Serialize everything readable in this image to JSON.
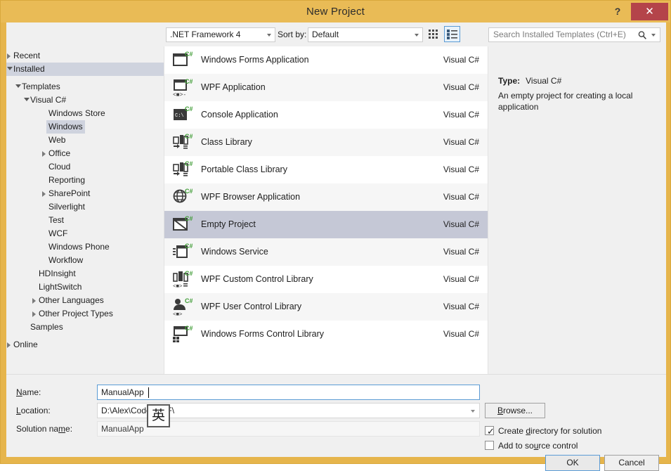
{
  "window": {
    "title": "New Project",
    "help_icon": "question-mark-icon",
    "close_label": "✕"
  },
  "toolbar": {
    "framework": ".NET Framework 4",
    "sort_by_label": "Sort by:",
    "sort_value": "Default",
    "view_medium_icon": "medium-icons-view-icon",
    "view_list_icon": "list-view-icon",
    "search_placeholder": "Search Installed Templates (Ctrl+E)",
    "search_value": "",
    "search_icon": "magnifier-icon"
  },
  "sidebar": {
    "items": [
      {
        "label": "Recent",
        "indent": 10,
        "glyph": "collapsed",
        "selected": false,
        "band": false
      },
      {
        "label": "Installed",
        "indent": 10,
        "glyph": "expanded",
        "selected": false,
        "band": true
      },
      {
        "label": "Templates",
        "indent": 22,
        "glyph": "expanded",
        "selected": false,
        "band": false
      },
      {
        "label": "Visual C#",
        "indent": 34,
        "glyph": "expanded",
        "selected": false,
        "band": false
      },
      {
        "label": "Windows Store",
        "indent": 60,
        "glyph": "none",
        "selected": false,
        "band": false
      },
      {
        "label": "Windows",
        "indent": 60,
        "glyph": "none",
        "selected": true,
        "band": false
      },
      {
        "label": "Web",
        "indent": 60,
        "glyph": "none",
        "selected": false,
        "band": false
      },
      {
        "label": "Office",
        "indent": 60,
        "glyph": "collapsed",
        "selected": false,
        "band": false
      },
      {
        "label": "Cloud",
        "indent": 60,
        "glyph": "none",
        "selected": false,
        "band": false
      },
      {
        "label": "Reporting",
        "indent": 60,
        "glyph": "none",
        "selected": false,
        "band": false
      },
      {
        "label": "SharePoint",
        "indent": 60,
        "glyph": "collapsed",
        "selected": false,
        "band": false
      },
      {
        "label": "Silverlight",
        "indent": 60,
        "glyph": "none",
        "selected": false,
        "band": false
      },
      {
        "label": "Test",
        "indent": 60,
        "glyph": "none",
        "selected": false,
        "band": false
      },
      {
        "label": "WCF",
        "indent": 60,
        "glyph": "none",
        "selected": false,
        "band": false
      },
      {
        "label": "Windows Phone",
        "indent": 60,
        "glyph": "none",
        "selected": false,
        "band": false
      },
      {
        "label": "Workflow",
        "indent": 60,
        "glyph": "none",
        "selected": false,
        "band": false
      },
      {
        "label": "HDInsight",
        "indent": 46,
        "glyph": "none",
        "selected": false,
        "band": false
      },
      {
        "label": "LightSwitch",
        "indent": 46,
        "glyph": "none",
        "selected": false,
        "band": false
      },
      {
        "label": "Other Languages",
        "indent": 46,
        "glyph": "collapsed",
        "selected": false,
        "band": false
      },
      {
        "label": "Other Project Types",
        "indent": 46,
        "glyph": "collapsed",
        "selected": false,
        "band": false
      },
      {
        "label": "Samples",
        "indent": 34,
        "glyph": "none",
        "selected": false,
        "band": false
      },
      {
        "label": "Online",
        "indent": 10,
        "glyph": "collapsed",
        "selected": false,
        "band": false
      }
    ]
  },
  "templates": {
    "items": [
      {
        "name": "Windows Forms Application",
        "lang": "Visual C#",
        "icon": "csharp-winforms-icon",
        "selected": false
      },
      {
        "name": "WPF Application",
        "lang": "Visual C#",
        "icon": "csharp-wpf-icon",
        "selected": false
      },
      {
        "name": "Console Application",
        "lang": "Visual C#",
        "icon": "csharp-console-icon",
        "selected": false
      },
      {
        "name": "Class Library",
        "lang": "Visual C#",
        "icon": "csharp-classlib-icon",
        "selected": false
      },
      {
        "name": "Portable Class Library",
        "lang": "Visual C#",
        "icon": "csharp-portable-classlib-icon",
        "selected": false
      },
      {
        "name": "WPF Browser Application",
        "lang": "Visual C#",
        "icon": "csharp-wpf-browser-icon",
        "selected": false
      },
      {
        "name": "Empty Project",
        "lang": "Visual C#",
        "icon": "csharp-empty-project-icon",
        "selected": true
      },
      {
        "name": "Windows Service",
        "lang": "Visual C#",
        "icon": "csharp-windows-service-icon",
        "selected": false
      },
      {
        "name": "WPF Custom Control Library",
        "lang": "Visual C#",
        "icon": "csharp-wpf-custom-control-icon",
        "selected": false
      },
      {
        "name": "WPF User Control Library",
        "lang": "Visual C#",
        "icon": "csharp-wpf-user-control-icon",
        "selected": false
      },
      {
        "name": "Windows Forms Control Library",
        "lang": "Visual C#",
        "icon": "csharp-winforms-control-icon",
        "selected": false
      }
    ]
  },
  "details": {
    "type_label": "Type:",
    "type_value": "Visual C#",
    "description": "An empty project for creating a local application"
  },
  "form": {
    "name_label": "Name:",
    "name_label_prefix": "N",
    "name_label_rest": "ame:",
    "name_value": "ManualApp",
    "location_label_prefix": "L",
    "location_label_rest": "ocation:",
    "location_value": "D:\\Alex\\Code\\WPF\\",
    "solution_label_a": "Solution na",
    "solution_label_m": "m",
    "solution_label_b": "e:",
    "solution_value": "ManualApp",
    "ime_indicator": "英"
  },
  "actions": {
    "browse_prefix": "B",
    "browse_rest": "rowse...",
    "create_dir_a": "Create ",
    "create_dir_d": "d",
    "create_dir_b": "irectory for solution",
    "create_dir_checked": true,
    "source_ctl_a": "Add to so",
    "source_ctl_u": "u",
    "source_ctl_b": "rce control",
    "source_ctl_checked": false,
    "ok_label": "OK",
    "cancel_label": "Cancel"
  },
  "colors": {
    "window_frame": "#e6b54c",
    "titlebar": "#e9bb56",
    "close_button": "#b4444a",
    "selection_row": "#c5c8d6",
    "tree_selection": "#cfd3de",
    "focus_border": "#5b9bd5",
    "csharp_badge": "#3f9c35"
  }
}
